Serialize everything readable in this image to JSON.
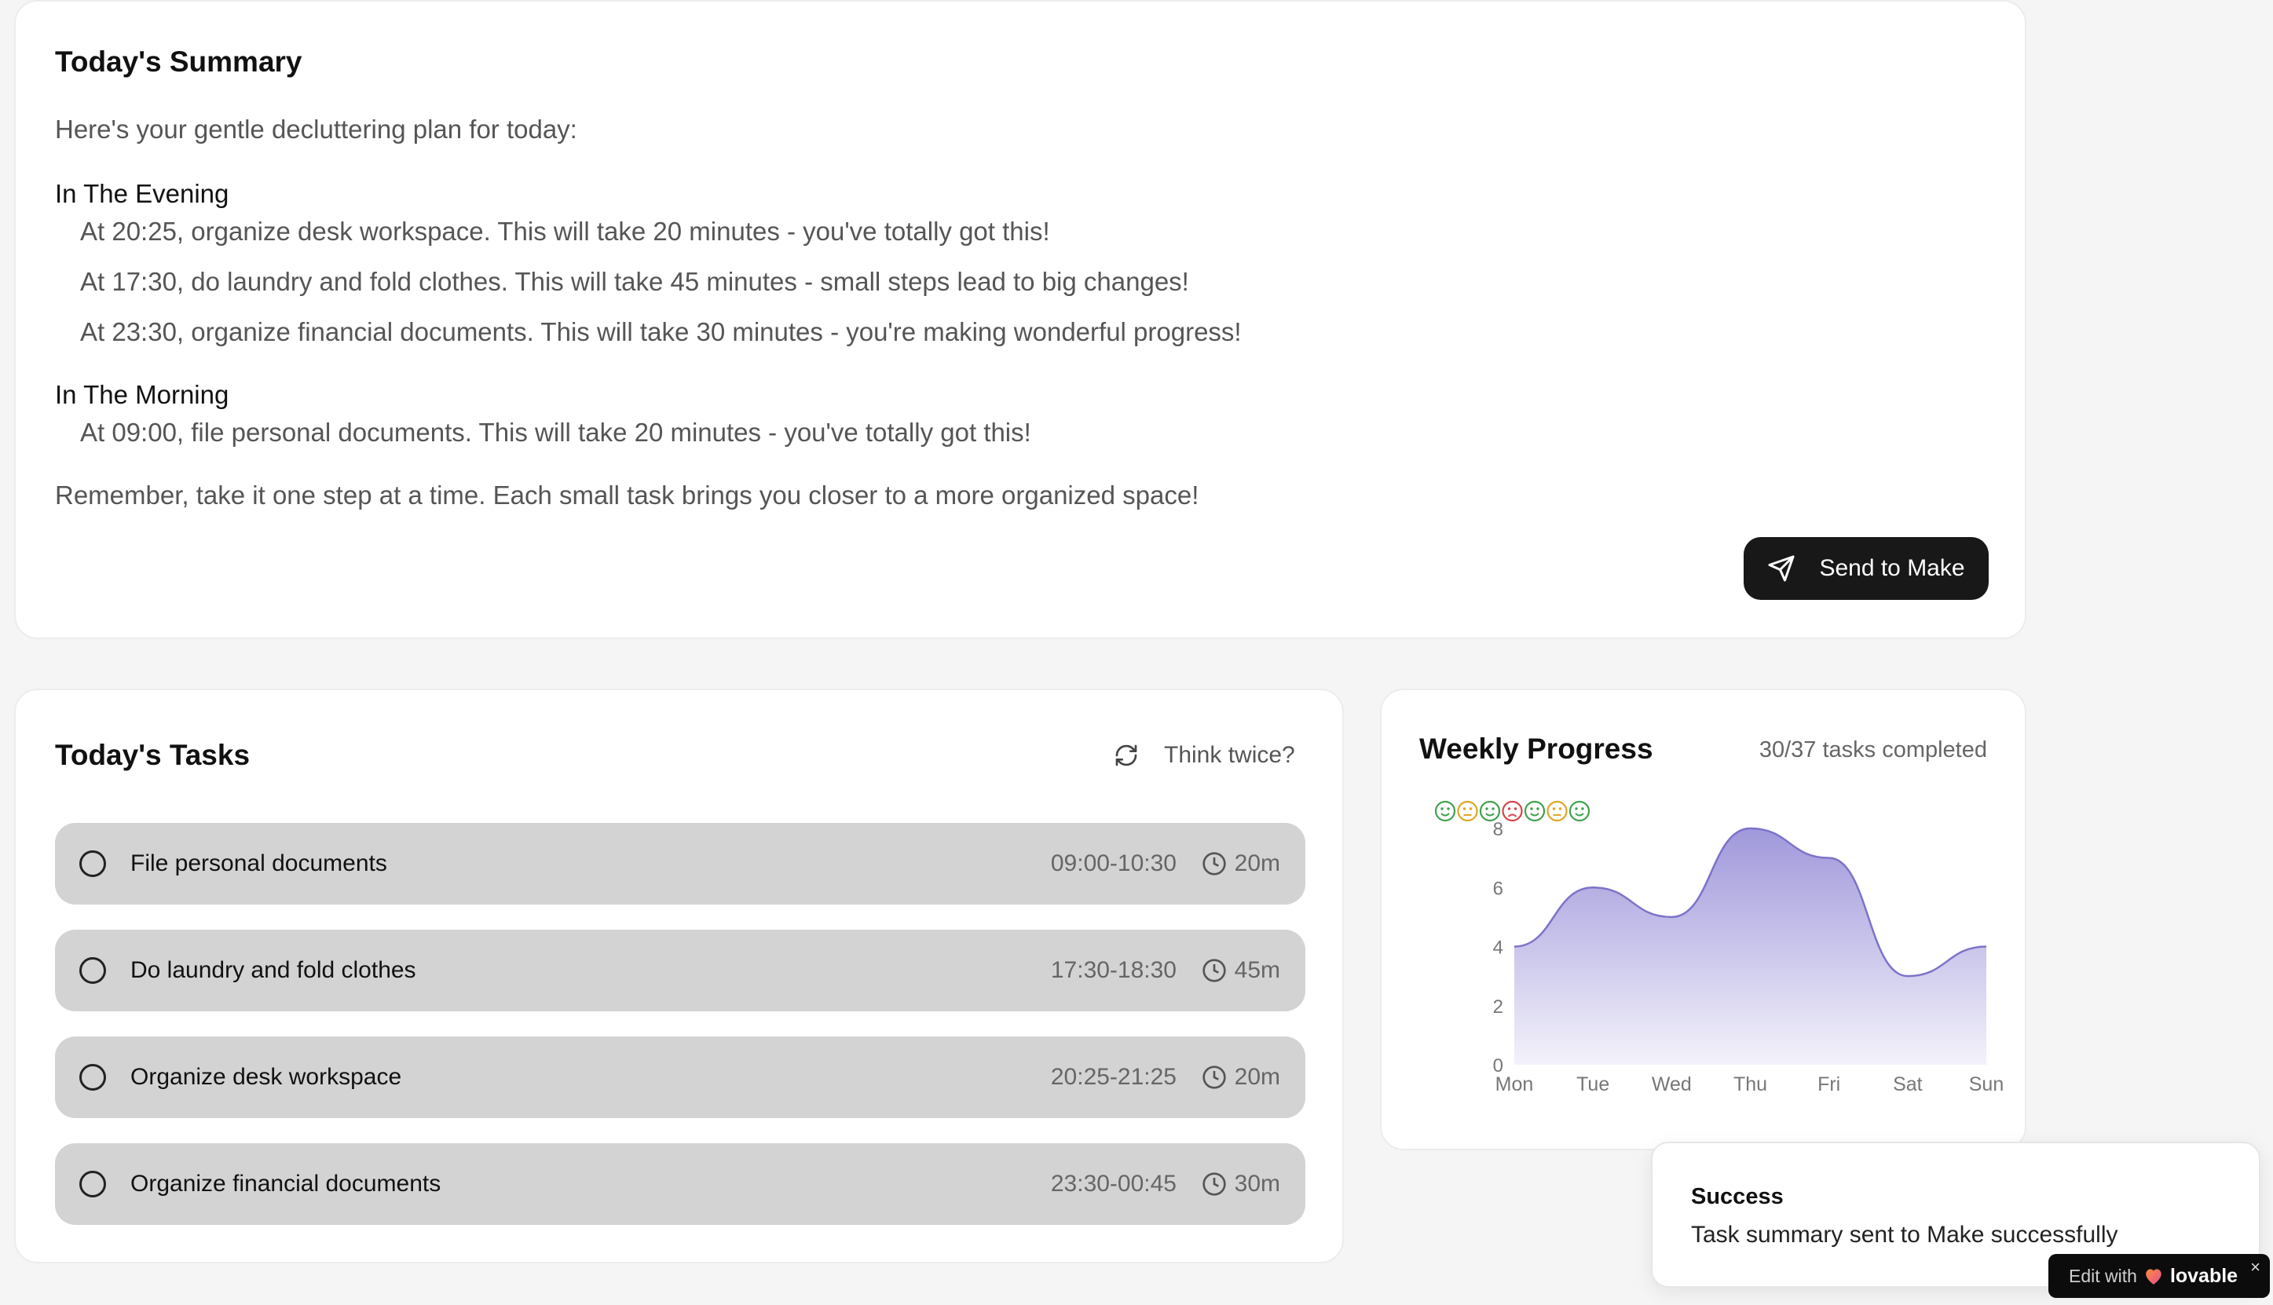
{
  "summary": {
    "title": "Today's Summary",
    "intro": "Here's your gentle decluttering plan for today:",
    "sections": [
      {
        "heading": "In The Evening",
        "items": [
          "At 20:25, organize desk workspace. This will take 20 minutes - you've totally got this!",
          "At 17:30, do laundry and fold clothes. This will take 45 minutes - small steps lead to big changes!",
          "At 23:30, organize financial documents. This will take 30 minutes - you're making wonderful progress!"
        ]
      },
      {
        "heading": "In The Morning",
        "items": [
          "At 09:00, file personal documents. This will take 20 minutes - you've totally got this!"
        ]
      }
    ],
    "closing": "Remember, take it one step at a time. Each small task brings you closer to a more organized space!",
    "send_button": "Send to Make",
    "send_icon": "send-icon"
  },
  "tasks": {
    "title": "Today's Tasks",
    "think_twice": "Think twice?",
    "items": [
      {
        "name": "File personal documents",
        "time": "09:00-10:30",
        "duration": "20m",
        "completed": false
      },
      {
        "name": "Do laundry and fold clothes",
        "time": "17:30-18:30",
        "duration": "45m",
        "completed": false
      },
      {
        "name": "Organize desk workspace",
        "time": "20:25-21:25",
        "duration": "20m",
        "completed": false
      },
      {
        "name": "Organize financial documents",
        "time": "23:30-00:45",
        "duration": "30m",
        "completed": false
      }
    ]
  },
  "progress": {
    "title": "Weekly Progress",
    "count": "30/37 tasks completed",
    "moods": [
      {
        "day": "Mon",
        "mood": "happy",
        "color": "#3fa34d"
      },
      {
        "day": "Tue",
        "mood": "neutral",
        "color": "#e0a526"
      },
      {
        "day": "Wed",
        "mood": "happy",
        "color": "#3fa34d"
      },
      {
        "day": "Thu",
        "mood": "sad",
        "color": "#d9434b"
      },
      {
        "day": "Fri",
        "mood": "happy",
        "color": "#3fa34d"
      },
      {
        "day": "Sat",
        "mood": "neutral",
        "color": "#e0a526"
      },
      {
        "day": "Sun",
        "mood": "happy",
        "color": "#3fa34d"
      }
    ]
  },
  "chart_data": {
    "type": "area",
    "categories": [
      "Mon",
      "Tue",
      "Wed",
      "Thu",
      "Fri",
      "Sat",
      "Sun"
    ],
    "values": [
      4,
      6,
      5,
      8,
      7,
      3,
      4
    ],
    "ylim": [
      0,
      8
    ],
    "yticks": [
      "0",
      "2",
      "4",
      "6",
      "8"
    ],
    "color": "#9b93d9",
    "grid": false
  },
  "toast": {
    "title": "Success",
    "message": "Task summary sent to Make successfully"
  },
  "badge": {
    "prefix": "Edit with",
    "brand": "lovable",
    "close": "×"
  }
}
